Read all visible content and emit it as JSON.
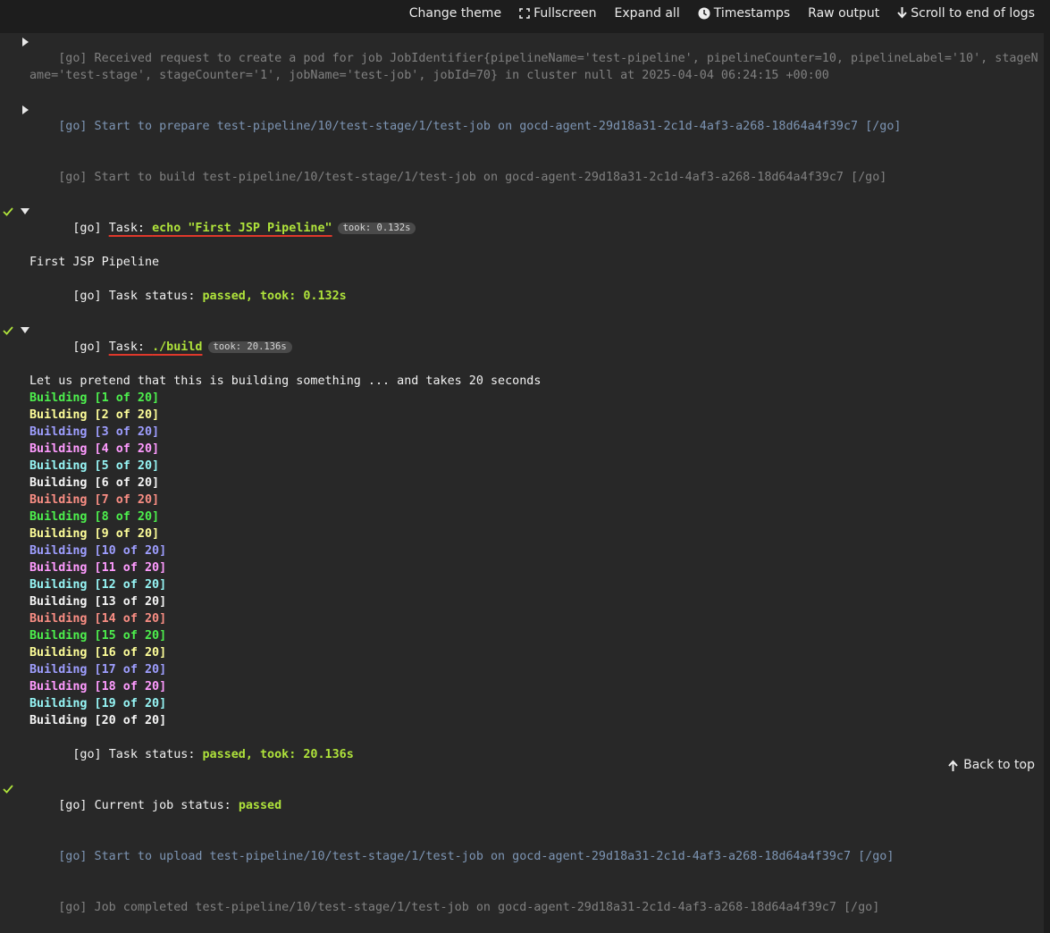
{
  "toolbar": {
    "change_theme": "Change theme",
    "fullscreen": "Fullscreen",
    "expand_all": "Expand all",
    "timestamps": "Timestamps",
    "raw_output": "Raw output",
    "scroll_to_end": "Scroll to end of logs"
  },
  "log": {
    "prefix": "[go]",
    "received": " Received request to create a pod for job JobIdentifier{pipelineName='test-pipeline', pipelineCounter=10, pipelineLabel='10', stageName='test-stage', stageCounter='1', jobName='test-job', jobId=70} in cluster null at 2025-04-04 06:24:15 +00:00",
    "prepare": " Start to prepare test-pipeline/10/test-stage/1/test-job on gocd-agent-29d18a31-2c1d-4af3-a268-18d64a4f39c7 [/go]",
    "build": " Start to build test-pipeline/10/test-stage/1/test-job on gocd-agent-29d18a31-2c1d-4af3-a268-18d64a4f39c7 [/go]",
    "task1": {
      "label": "Task: ",
      "command": "echo \"First JSP Pipeline\"",
      "took": "took: 0.132s",
      "output": "First JSP Pipeline",
      "status_label": "Task status: ",
      "status_value": "passed, took: 0.132s"
    },
    "task2": {
      "label": "Task: ",
      "command": "./build",
      "took": "took: 20.136s",
      "intro": "Let us pretend that this is building something ... and takes 20 seconds",
      "status_label": "Task status: ",
      "status_value": "passed, took: 20.136s"
    },
    "building_lines": [
      "Building [1 of 20]",
      "Building [2 of 20]",
      "Building [3 of 20]",
      "Building [4 of 20]",
      "Building [5 of 20]",
      "Building [6 of 20]",
      "Building [7 of 20]",
      "Building [8 of 20]",
      "Building [9 of 20]",
      "Building [10 of 20]",
      "Building [11 of 20]",
      "Building [12 of 20]",
      "Building [13 of 20]",
      "Building [14 of 20]",
      "Building [15 of 20]",
      "Building [16 of 20]",
      "Building [17 of 20]",
      "Building [18 of 20]",
      "Building [19 of 20]",
      "Building [20 of 20]"
    ],
    "job_status_label": "Current job status: ",
    "job_status_value": "passed",
    "upload": " Start to upload test-pipeline/10/test-stage/1/test-job on gocd-agent-29d18a31-2c1d-4af3-a268-18d64a4f39c7 [/go]",
    "completed": " Job completed test-pipeline/10/test-stage/1/test-job on gocd-agent-29d18a31-2c1d-4af3-a268-18d64a4f39c7 [/go]"
  },
  "footer": {
    "back_to_top": "Back to top"
  },
  "colors": {
    "background": "#1d1d1d",
    "section_bg": "#282828",
    "passed_green": "#afe33b",
    "underline_red": "#e0382b",
    "info_blue": "#7d95b4",
    "muted_gray": "#808080",
    "building_palette": [
      "#4df04d",
      "#fefe99",
      "#9e9eff",
      "#ff9bff",
      "#96f5f5",
      "#f5f5f5",
      "#fa8e84"
    ]
  },
  "icons": [
    "fullscreen-icon",
    "clock-icon",
    "arrow-down-icon",
    "arrow-up-icon",
    "caret-right-icon",
    "caret-down-icon",
    "check-icon"
  ]
}
